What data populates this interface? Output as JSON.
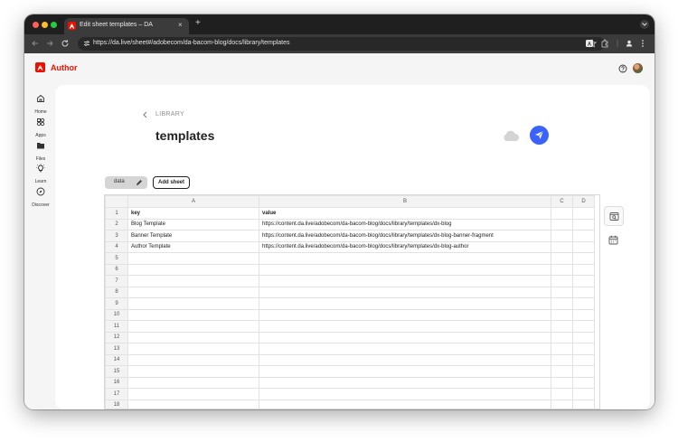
{
  "browser": {
    "tab_title": "Edit sheet templates – DA",
    "tab_close": "×",
    "new_tab": "+",
    "url": "https://da.live/sheet#/adobecom/da-bacom-blog/docs/library/templates"
  },
  "app": {
    "brand_name": "Author",
    "brand_color": "#eb1000",
    "accent_color": "#3b63fb"
  },
  "sidebar": {
    "items": [
      {
        "label": "Home",
        "icon": "home-icon"
      },
      {
        "label": "Apps",
        "icon": "apps-icon"
      },
      {
        "label": "Files",
        "icon": "folder-icon"
      },
      {
        "label": "Learn",
        "icon": "lightbulb-icon"
      },
      {
        "label": "Discover",
        "icon": "compass-icon"
      }
    ]
  },
  "header": {
    "breadcrumb": "LIBRARY",
    "title": "templates"
  },
  "sheet_tabs": {
    "active": "data",
    "add_label": "Add sheet"
  },
  "grid": {
    "columns": [
      "A",
      "B",
      "C",
      "D"
    ],
    "rows": [
      {
        "n": "1",
        "cells": [
          "key",
          "value",
          "",
          ""
        ]
      },
      {
        "n": "2",
        "cells": [
          "Blog Template",
          "https://content.da.live/adobecom/da-bacom-blog/docs/library/templates/dx-blog",
          "",
          ""
        ]
      },
      {
        "n": "3",
        "cells": [
          "Banner Template",
          "https://content.da.live/adobecom/da-bacom-blog/docs/library/templates/dx-blog-banner-fragment",
          "",
          ""
        ]
      },
      {
        "n": "4",
        "cells": [
          "Author Template",
          "https://content.da.live/adobecom/da-bacom-blog/docs/library/templates/dx-blog-author",
          "",
          ""
        ]
      },
      {
        "n": "5",
        "cells": [
          "",
          "",
          "",
          ""
        ]
      },
      {
        "n": "6",
        "cells": [
          "",
          "",
          "",
          ""
        ]
      },
      {
        "n": "7",
        "cells": [
          "",
          "",
          "",
          ""
        ]
      },
      {
        "n": "8",
        "cells": [
          "",
          "",
          "",
          ""
        ]
      },
      {
        "n": "9",
        "cells": [
          "",
          "",
          "",
          ""
        ]
      },
      {
        "n": "10",
        "cells": [
          "",
          "",
          "",
          ""
        ]
      },
      {
        "n": "11",
        "cells": [
          "",
          "",
          "",
          ""
        ]
      },
      {
        "n": "12",
        "cells": [
          "",
          "",
          "",
          ""
        ]
      },
      {
        "n": "13",
        "cells": [
          "",
          "",
          "",
          ""
        ]
      },
      {
        "n": "14",
        "cells": [
          "",
          "",
          "",
          ""
        ]
      },
      {
        "n": "15",
        "cells": [
          "",
          "",
          "",
          ""
        ]
      },
      {
        "n": "16",
        "cells": [
          "",
          "",
          "",
          ""
        ]
      },
      {
        "n": "17",
        "cells": [
          "",
          "",
          "",
          ""
        ]
      },
      {
        "n": "18",
        "cells": [
          "",
          "",
          "",
          ""
        ]
      }
    ]
  }
}
